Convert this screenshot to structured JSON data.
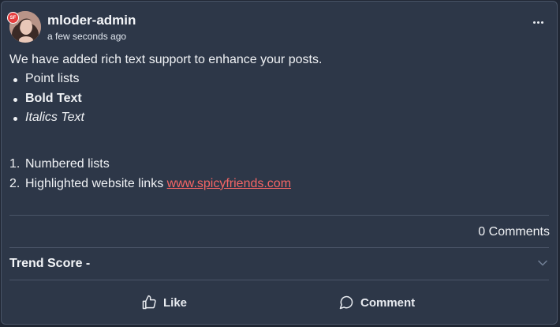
{
  "post": {
    "author": {
      "username": "mloder-admin",
      "avatar_badge": "SF",
      "timestamp": "a few seconds ago"
    },
    "menu_icon": "more-horizontal-icon",
    "body": {
      "intro": "We have added rich text support to enhance your posts.",
      "bullets": [
        "Point lists",
        "Bold Text",
        "Italics Text"
      ],
      "numbered": [
        {
          "number": "1.",
          "text": "Numbered lists"
        },
        {
          "number": "2.",
          "text": "Highlighted website links ",
          "link": "www.spicyfriends.com"
        }
      ]
    },
    "comments_count": "0 Comments",
    "trend_score_label": "Trend Score -",
    "actions": {
      "like_label": "Like",
      "comment_label": "Comment"
    }
  },
  "colors": {
    "background": "#2d3748",
    "border": "#4a5568",
    "link": "#f56565",
    "badge": "#e53e3e",
    "text": "#f0f2f5"
  }
}
